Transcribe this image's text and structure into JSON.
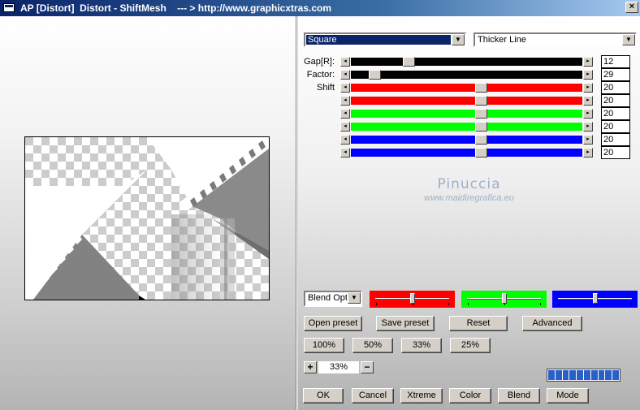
{
  "window": {
    "title": "AP [Distort]  Distort - ShiftMesh    --- > http://www.graphicxtras.com",
    "close_glyph": "×"
  },
  "controls": {
    "mode_select": {
      "value": "Square"
    },
    "line_select": {
      "value": "Thicker Line"
    },
    "sliders": [
      {
        "label": "Gap[R]:",
        "value": "12",
        "position": 0.25,
        "color": "#000000"
      },
      {
        "label": "Factor:",
        "value": "29",
        "position": 0.1,
        "color": "#000000"
      },
      {
        "label": "Shift",
        "value": "20",
        "position": 0.56,
        "color": "#ff0000"
      },
      {
        "label": "",
        "value": "20",
        "position": 0.56,
        "color": "#ff0000"
      },
      {
        "label": "",
        "value": "20",
        "position": 0.56,
        "color": "#00ff00"
      },
      {
        "label": "",
        "value": "20",
        "position": 0.56,
        "color": "#00ff00"
      },
      {
        "label": "",
        "value": "20",
        "position": 0.56,
        "color": "#0000ff"
      },
      {
        "label": "",
        "value": "20",
        "position": 0.56,
        "color": "#0000ff"
      }
    ],
    "blend_select": {
      "value": "Blend Optio"
    },
    "color_sliders": [
      {
        "color": "#ff0000",
        "position": 0.5
      },
      {
        "color": "#00ff00",
        "position": 0.5
      },
      {
        "color": "#0000ff",
        "position": 0.5
      }
    ],
    "buttons_row1": [
      "Open preset",
      "Save preset",
      "Reset",
      "Advanced"
    ],
    "zoom_buttons": [
      "100%",
      "50%",
      "33%",
      "25%"
    ],
    "zoom": {
      "value": "33%",
      "plus": "+",
      "minus": "−"
    },
    "bottom_buttons": [
      "OK",
      "Cancel",
      "Xtreme",
      "Color",
      "Blend",
      "Mode"
    ],
    "progress_segments": 10
  },
  "watermark": {
    "name": "Pinuccia",
    "url": "www.maidiregrafica.eu"
  }
}
